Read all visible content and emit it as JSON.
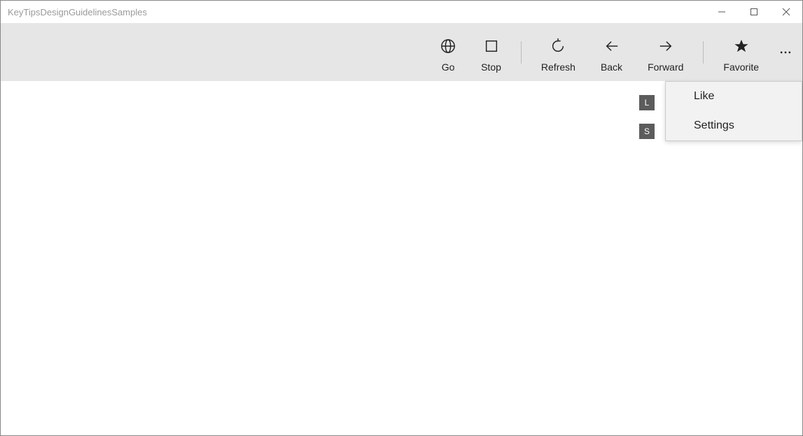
{
  "window": {
    "title": "KeyTipsDesignGuidelinesSamples"
  },
  "commands": {
    "go": "Go",
    "stop": "Stop",
    "refresh": "Refresh",
    "back": "Back",
    "forward": "Forward",
    "favorite": "Favorite"
  },
  "menu": {
    "like": "Like",
    "settings": "Settings"
  },
  "keytips": {
    "like": "L",
    "settings": "S"
  }
}
